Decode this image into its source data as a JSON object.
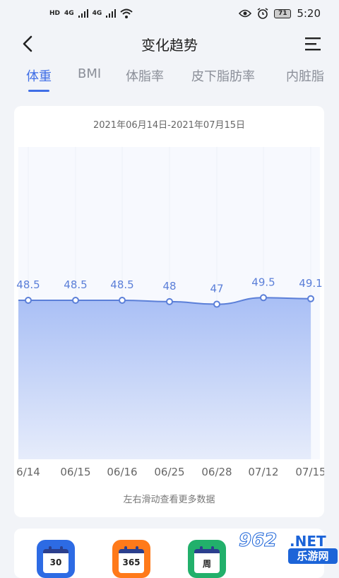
{
  "status_bar": {
    "sim1_label": "HD",
    "sim1_network": "4G",
    "sim2_label": "HD",
    "sim2_network": "4G",
    "battery": "71",
    "time": "5:20",
    "icons": [
      "signal-icon",
      "wifi-icon",
      "eye-icon",
      "alarm-icon",
      "battery-icon"
    ]
  },
  "header": {
    "title": "变化趋势",
    "back_icon": "chevron-left-icon",
    "menu_icon": "menu-icon"
  },
  "tabs": [
    {
      "label": "体重",
      "active": true
    },
    {
      "label": "BMI",
      "active": false
    },
    {
      "label": "体脂率",
      "active": false
    },
    {
      "label": "皮下脂肪率",
      "active": false
    },
    {
      "label": "内脏脂",
      "active": false
    }
  ],
  "chart_card": {
    "date_range": "2021年06月14日-2021年07月15日",
    "hint": "左右滑动查看更多数据"
  },
  "chart_data": {
    "type": "area",
    "categories": [
      "6/14",
      "06/15",
      "06/16",
      "06/25",
      "06/28",
      "07/12",
      "07/15"
    ],
    "values": [
      48.5,
      48.5,
      48.5,
      48,
      47,
      49.5,
      49.1
    ],
    "value_labels": [
      "48.5",
      "48.5",
      "48.5",
      "48",
      "47",
      "49.5",
      "49.1"
    ],
    "colors": {
      "line": "#5b7fd8",
      "fill_top": "#a9bff5",
      "fill_bottom": "#e6ecfb",
      "label": "#5b7fd8"
    }
  },
  "shortcuts": [
    {
      "label": "30",
      "color": "#2d6be4",
      "icon": "calendar-30-icon"
    },
    {
      "label": "365",
      "color": "#ff7a1a",
      "icon": "calendar-365-icon"
    },
    {
      "label": "周",
      "color": "#22b06b",
      "icon": "calendar-week-icon"
    }
  ],
  "watermark": {
    "number": "962",
    "suffix": ".NET",
    "sub": "乐游网"
  }
}
